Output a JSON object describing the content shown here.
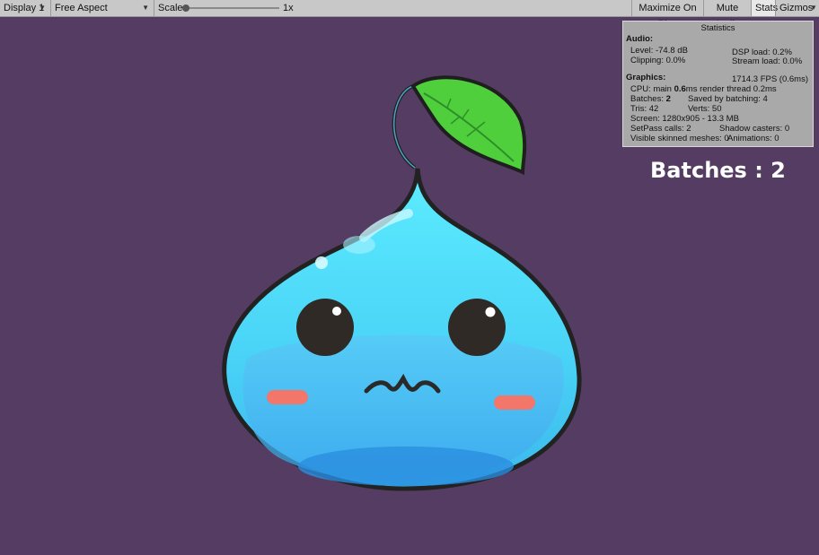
{
  "toolbar": {
    "display": "Display 1",
    "aspect": "Free Aspect",
    "scale_label": "Scale",
    "scale_value": "1x",
    "maximize": "Maximize On Play",
    "mute": "Mute Audio",
    "stats": "Stats",
    "gizmos": "Gizmos"
  },
  "stats": {
    "title": "Statistics",
    "audio_header": "Audio:",
    "level": "Level: -74.8 dB",
    "clipping": "Clipping: 0.0%",
    "dsp": "DSP load: 0.2%",
    "stream": "Stream load: 0.0%",
    "graphics_header": "Graphics:",
    "fps": "1714.3 FPS (0.6ms)",
    "cpu_prefix": "CPU: main",
    "cpu_main": "0.6",
    "cpu_suffix": "ms  render thread 0.2ms",
    "batches_label": "Batches:",
    "batches_value": "2",
    "saved": "Saved by batching: 4",
    "tris": "Tris: 42",
    "verts": "Verts: 50",
    "screen": "Screen: 1280x905 - 13.3 MB",
    "setpass": "SetPass calls: 2",
    "shadow": "Shadow casters: 0",
    "skinned": "Visible skinned meshes: 0",
    "animations": "Animations: 0"
  },
  "annotation": "Batches : 2",
  "colors": {
    "background": "#553c62",
    "toolbar": "#c8c8c8",
    "stats_panel": "#a9a9a9",
    "slime_body": "#4fd9f2",
    "leaf": "#4fcf3c"
  }
}
